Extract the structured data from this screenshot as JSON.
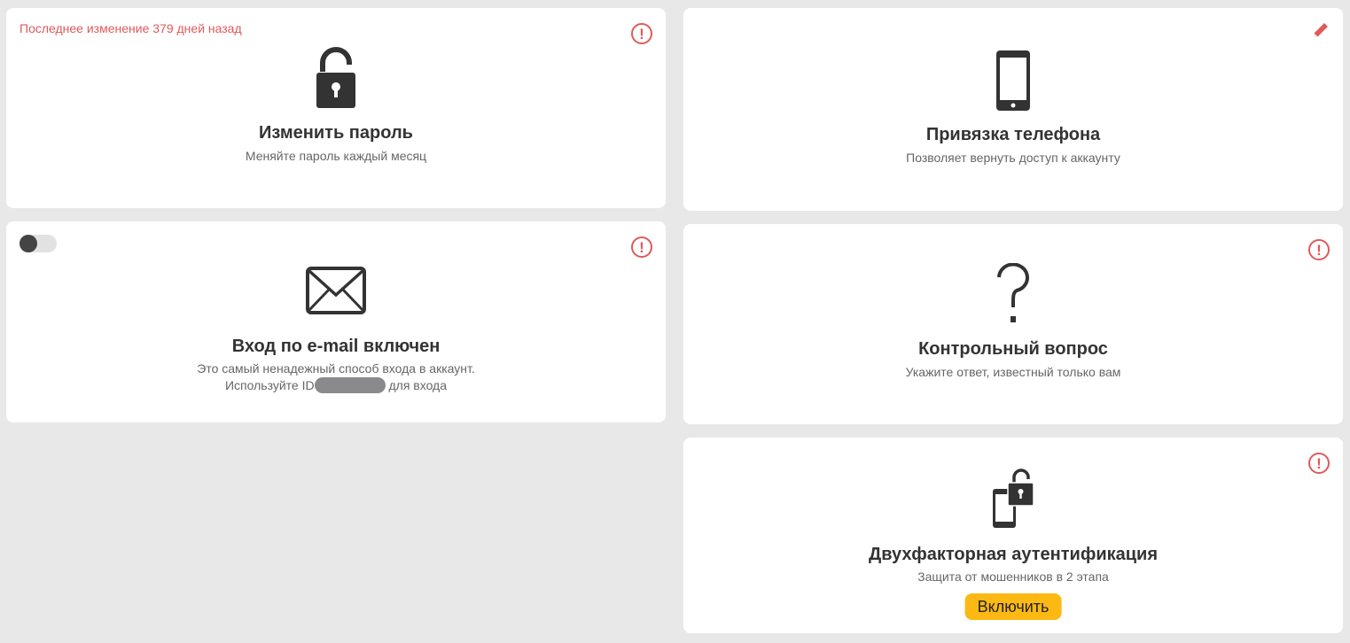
{
  "password_card": {
    "last_change": "Последнее изменение 379 дней назад",
    "title": "Изменить пароль",
    "description": "Меняйте пароль каждый месяц",
    "icon": "lock-open-icon"
  },
  "phone_card": {
    "title": "Привязка телефона",
    "description": "Позволяет вернуть доступ к аккаунту",
    "icon": "smartphone-icon",
    "action_icon": "pencil-icon"
  },
  "email_card": {
    "title": "Вход по e-mail включен",
    "description_line1": "Это самый ненадежный способ входа в аккаунт.",
    "description_line2_prefix": "Используйте ID",
    "description_line2_suffix": " для входа",
    "icon": "envelope-icon",
    "toggle_on": false
  },
  "question_card": {
    "title": "Контрольный вопрос",
    "description": "Укажите ответ, известный только вам",
    "icon": "question-mark-icon"
  },
  "twofa_card": {
    "title": "Двухфакторная аутентификация",
    "description": "Защита от мошенников в 2 этапа",
    "button_label": "Включить",
    "icon": "phone-lock-icon"
  },
  "colors": {
    "warning": "#e05a5a",
    "accent_button": "#fcb913",
    "background": "#e8e8e8",
    "icon": "#333333"
  },
  "warning_glyph": "!"
}
